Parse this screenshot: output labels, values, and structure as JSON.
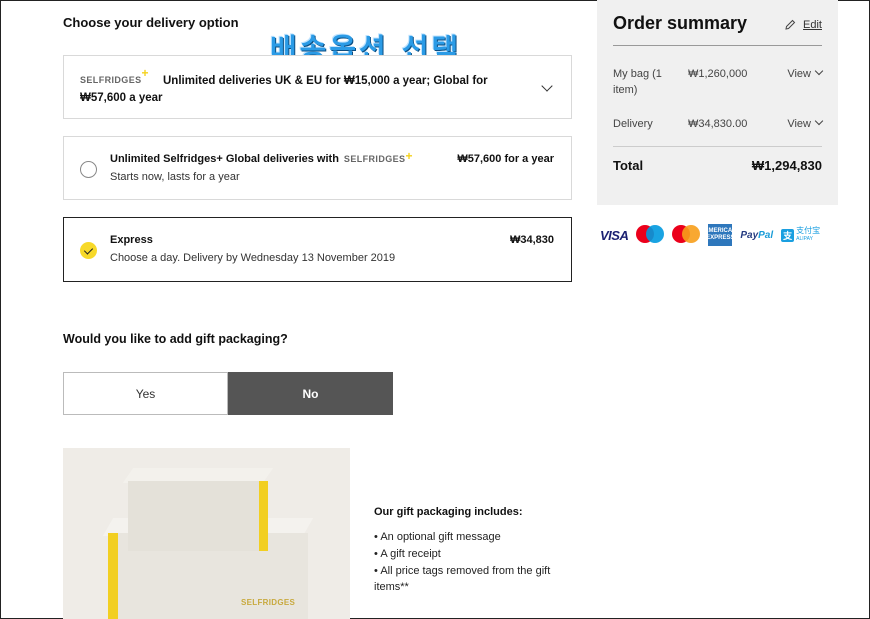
{
  "delivery": {
    "heading": "Choose your delivery option",
    "overlay_korean": "배송옵션 선택",
    "unlimited_card": {
      "logo": "SELFRIDGES",
      "logo_plus": "+",
      "text": "Unlimited deliveries UK & EU for ₩15,000 a year; Global for ₩57,600 a year"
    },
    "options": [
      {
        "title": "Unlimited Selfridges+ Global deliveries with",
        "logo": "SELFRIDGES",
        "logo_plus": "+",
        "subtitle": "Starts now, lasts for a year",
        "price": "₩57,600 for a year",
        "selected": false
      },
      {
        "title": "Express",
        "subtitle": "Choose a day. Delivery by Wednesday 13 November 2019",
        "price": "₩34,830",
        "selected": true
      }
    ]
  },
  "gift": {
    "question": "Would you like to add gift packaging?",
    "yes_label": "Yes",
    "no_label": "No",
    "selected": "No",
    "image_logo": "SELFRIDGES",
    "includes_title": "Our gift packaging includes:",
    "includes": [
      "An optional gift message",
      "A gift receipt",
      "All price tags removed from the gift items**"
    ]
  },
  "summary": {
    "title": "Order summary",
    "edit_label": "Edit",
    "rows": [
      {
        "label": "My bag (1 item)",
        "value": "₩1,260,000",
        "view": "View"
      },
      {
        "label": "Delivery",
        "value": "₩34,830.00",
        "view": "View"
      }
    ],
    "total_label": "Total",
    "total_value": "₩1,294,830"
  },
  "payments": {
    "visa": "VISA",
    "amex": "AMERICAN EXPRESS",
    "paypal_a": "Pay",
    "paypal_b": "Pal",
    "alipay_glyph": "支",
    "alipay_text": "支付宝",
    "alipay_sub": "ALIPAY"
  },
  "colors": {
    "accent_yellow": "#f7d929",
    "toggle_selected": "#555555",
    "summary_bg": "#f0f0f0",
    "overlay_blue": "#2b9be6",
    "mastercard_red": "#eb001b",
    "mastercard_orange": "#f79e1b",
    "maestro_blue": "#0099df"
  }
}
